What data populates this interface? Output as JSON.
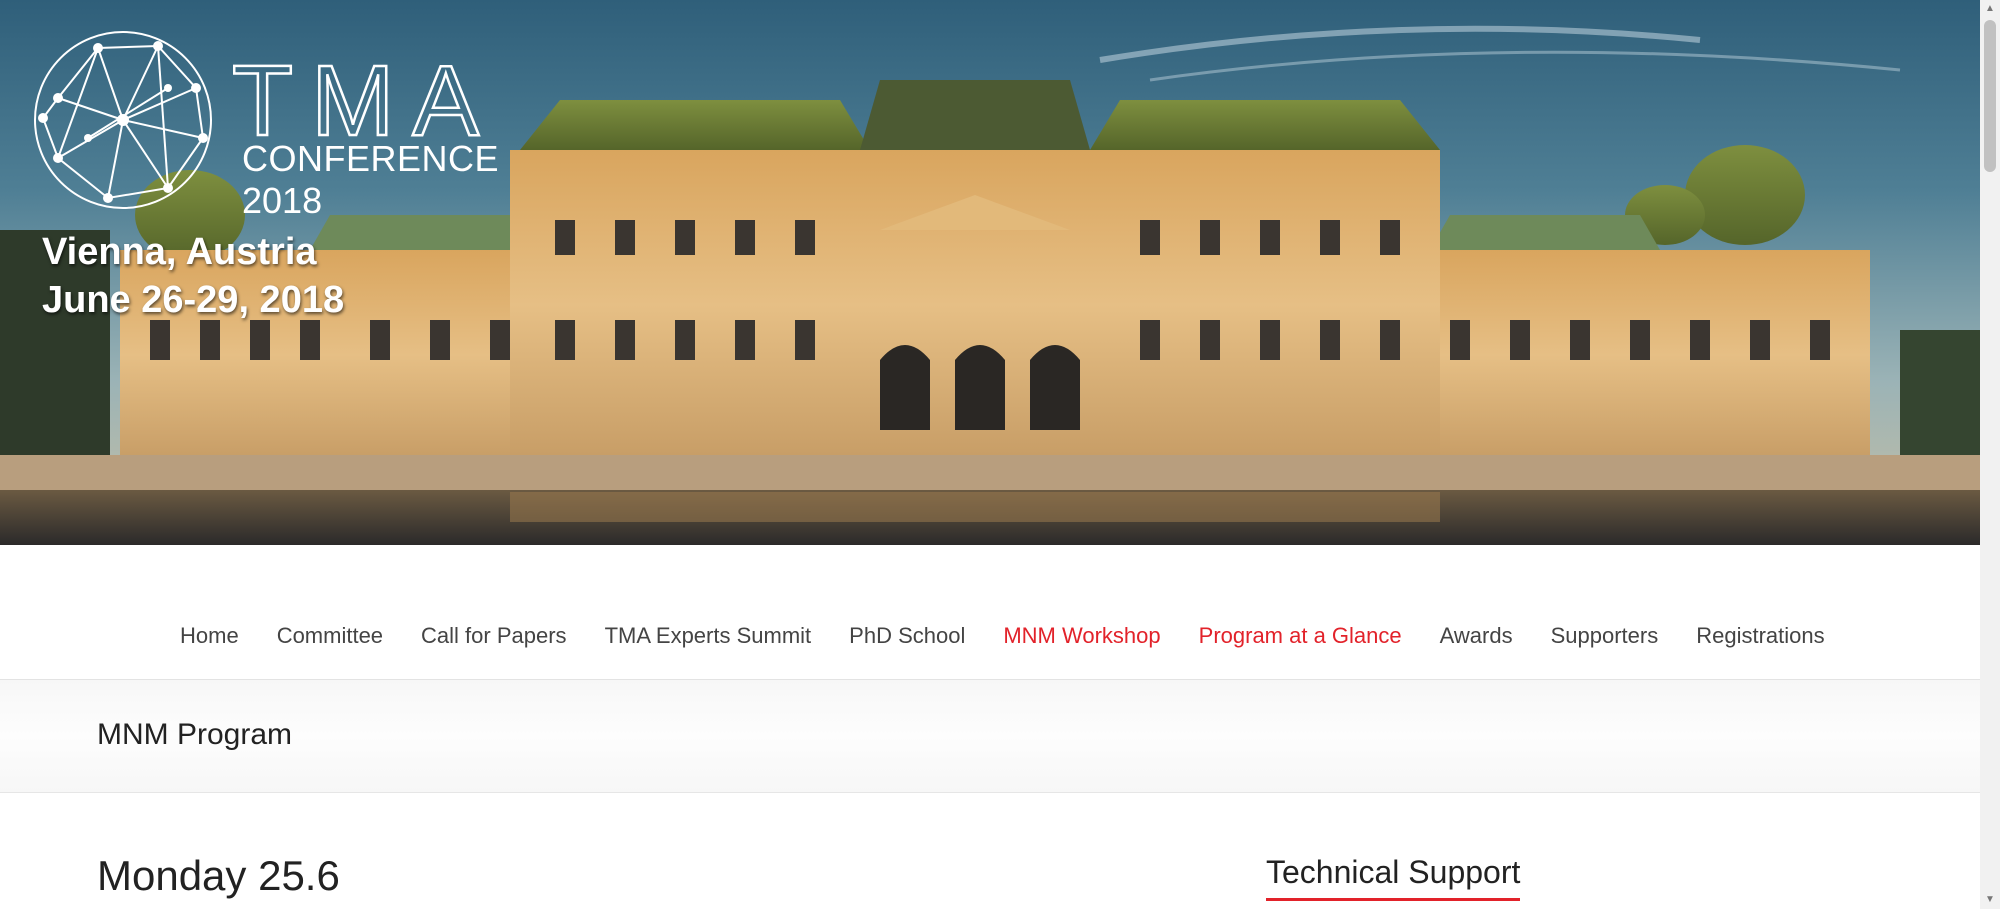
{
  "banner": {
    "logo_word": "TMA",
    "logo_sub": "CONFERENCE",
    "logo_year": "2018",
    "location": "Vienna, Austria",
    "dates": "June 26-29, 2018"
  },
  "nav": {
    "items": [
      {
        "label": "Home"
      },
      {
        "label": "Committee"
      },
      {
        "label": "Call for Papers"
      },
      {
        "label": "TMA Experts Summit"
      },
      {
        "label": "PhD School"
      },
      {
        "label": "MNM Workshop"
      },
      {
        "label": "Program at a Glance"
      },
      {
        "label": "Awards"
      },
      {
        "label": "Supporters"
      },
      {
        "label": "Registrations"
      }
    ],
    "active_color": "#e2222a"
  },
  "page": {
    "title": "MNM Program",
    "section_heading": "Monday 25.6",
    "sidebar_heading": "Technical Support"
  }
}
